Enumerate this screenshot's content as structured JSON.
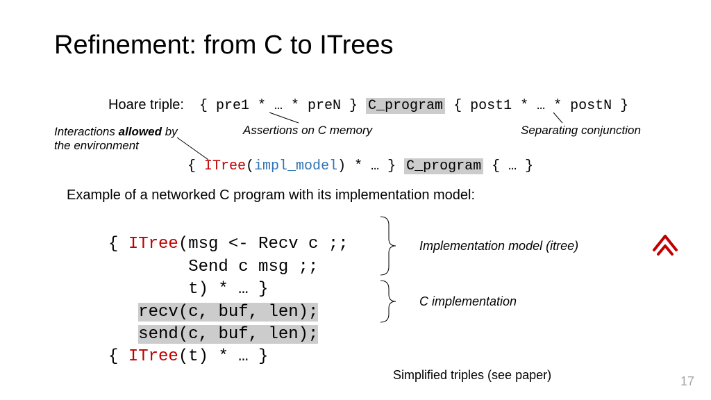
{
  "title": "Refinement: from C to ITrees",
  "hoare": {
    "label": "Hoare triple:",
    "pre": "{ pre1 * … * preN }",
    "prog": "C_program",
    "post": "{ post1 * … * postN }"
  },
  "annotations": {
    "interactions": "Interactions ",
    "interactions_bold": "allowed",
    "interactions_tail": " by the environment",
    "assertions": "Assertions on C memory",
    "sepconj": "Separating conjunction"
  },
  "refine": {
    "open": "{ ",
    "itree": "ITree",
    "lparen": "(",
    "impl": "impl_model",
    "tail1": ") * … } ",
    "prog": "C_program",
    "tail2": " { … }"
  },
  "example_caption": "Example of a networked C program with its implementation model:",
  "code": {
    "l1_open": "{ ",
    "l1_itree": "ITree",
    "l1_rest": "(msg <- Recv c ;;",
    "l2": "        Send c msg ;;",
    "l3": "        t) * … }",
    "l4_pad": "   ",
    "l4": "recv(c, buf, len);",
    "l5_pad": "   ",
    "l5": "send(c, buf, len);",
    "l6_open": "{ ",
    "l6_itree": "ITree",
    "l6_rest": "(t) * … }"
  },
  "brace_labels": {
    "impl_model": "Implementation model (itree)",
    "c_impl": "C implementation"
  },
  "footnote": "Simplified triples (see paper)",
  "page": "17"
}
